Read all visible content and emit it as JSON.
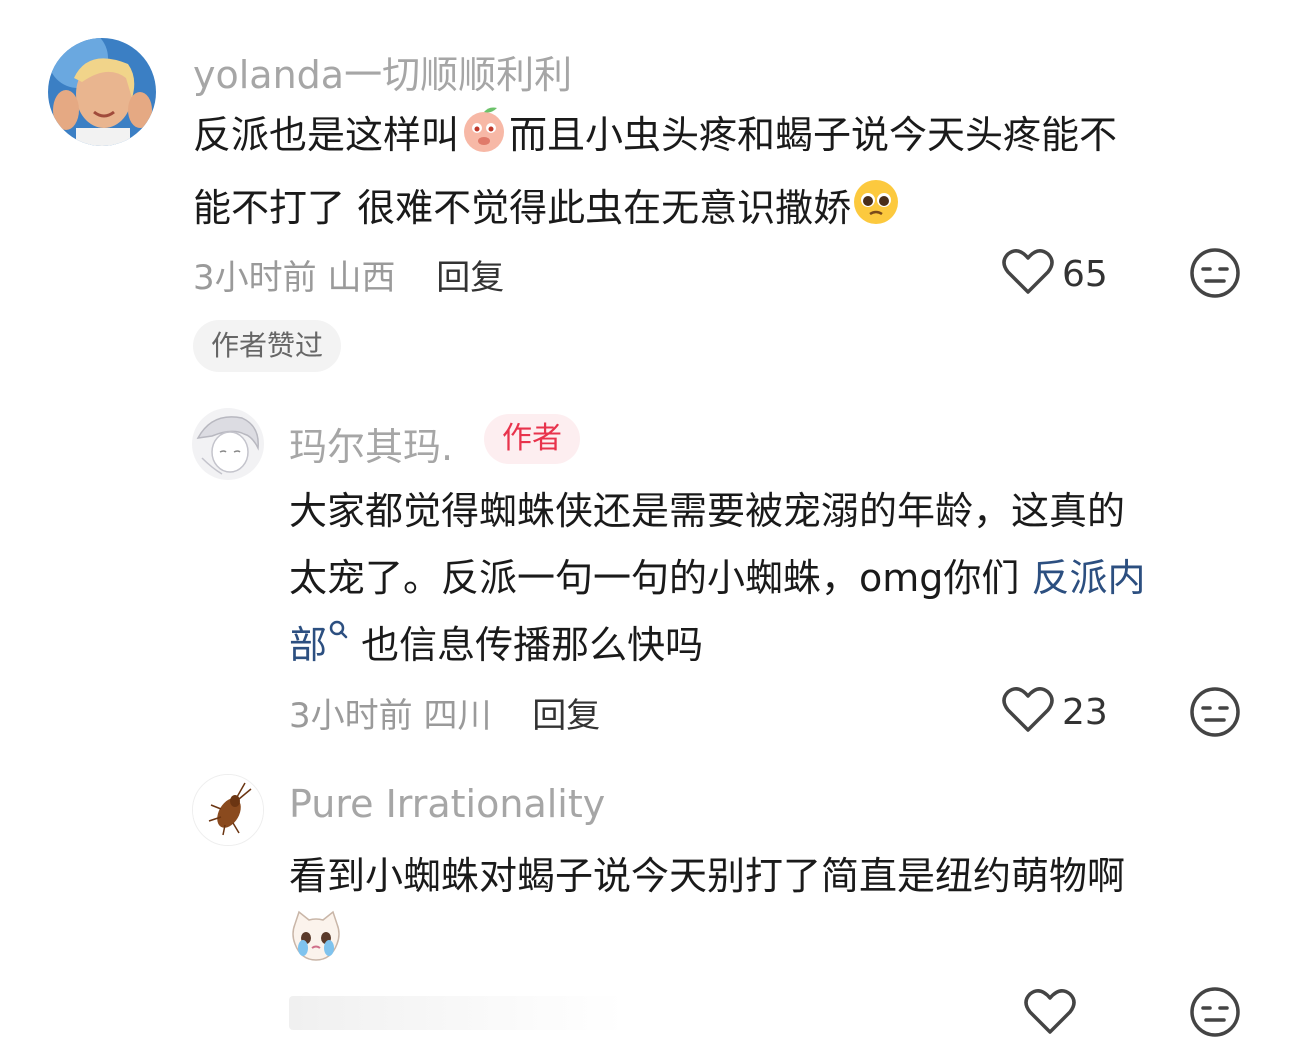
{
  "comments": [
    {
      "username": "yolanda一切顺顺利利",
      "text_line1a": "反派也是这样叫",
      "text_line1b": "而且小虫头疼和蝎子说今天头疼能不",
      "text_line2": "能不打了 很难不觉得此虫在无意识撒娇",
      "time": "3小时前",
      "location": "山西",
      "reply": "回复",
      "likes": "65",
      "badge": "作者赞过"
    },
    {
      "username": "玛尔其玛.",
      "author_tag": "作者",
      "text_line1": "大家都觉得蜘蛛侠还是需要被宠溺的年龄，这真的",
      "text_line2a": "太宠了。反派一句一句的小蜘蛛，omg你们 ",
      "link_a": "反派内",
      "link_b": "部",
      "text_line3": " 也信息传播那么快吗",
      "time": "3小时前",
      "location": "四川",
      "reply": "回复",
      "likes": "23"
    },
    {
      "username": "Pure Irrationality",
      "text_line1": "看到小蜘蛛对蝎子说今天别打了简直是纽约萌物啊"
    }
  ],
  "icons": {
    "like": "heart-outline-icon",
    "dislike": "meh-face-icon",
    "search": "search-icon"
  }
}
